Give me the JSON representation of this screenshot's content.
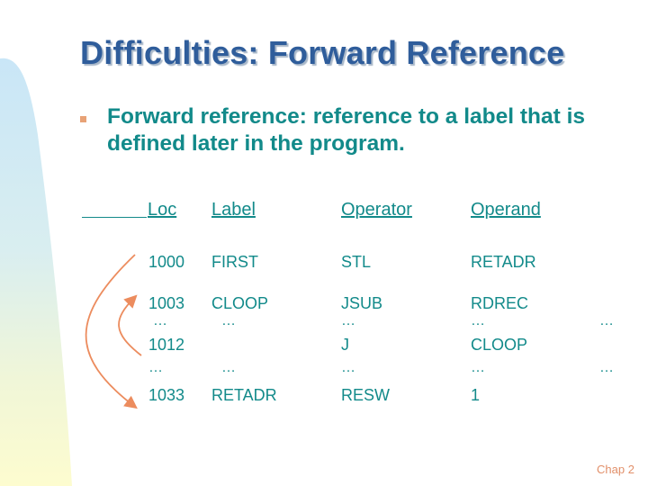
{
  "slide": {
    "title": "Difficulties: Forward Reference",
    "bullet": "Forward reference: reference to a label that is defined later in the program.",
    "footer": "Chap 2",
    "colors": {
      "title": "#2f5d9b",
      "body": "#128a8a",
      "accent": "#e8a276"
    }
  },
  "table": {
    "headers": [
      "Loc",
      "Label",
      "Operator",
      "Operand"
    ],
    "rows": [
      {
        "loc": "1000",
        "label": "FIRST",
        "operator": "STL",
        "operand": "RETADR"
      },
      {
        "loc": "1003",
        "label": "CLOOP",
        "operator": "JSUB",
        "operand": "RDREC"
      },
      {
        "loc": "…",
        "label": "…",
        "operator": "…",
        "operand": "…",
        "extra": "…"
      },
      {
        "loc": "1012",
        "label": "",
        "operator": "J",
        "operand": "CLOOP"
      },
      {
        "loc": "…",
        "label": "…",
        "operator": "…",
        "operand": "…",
        "extra": "…"
      },
      {
        "loc": "1033",
        "label": "RETADR",
        "operator": "RESW",
        "operand": "1"
      }
    ]
  },
  "arrows": [
    {
      "from": "1012",
      "to": "1003",
      "meaning": "backward reference"
    },
    {
      "from": "1000",
      "to": "1033",
      "meaning": "forward reference"
    }
  ]
}
